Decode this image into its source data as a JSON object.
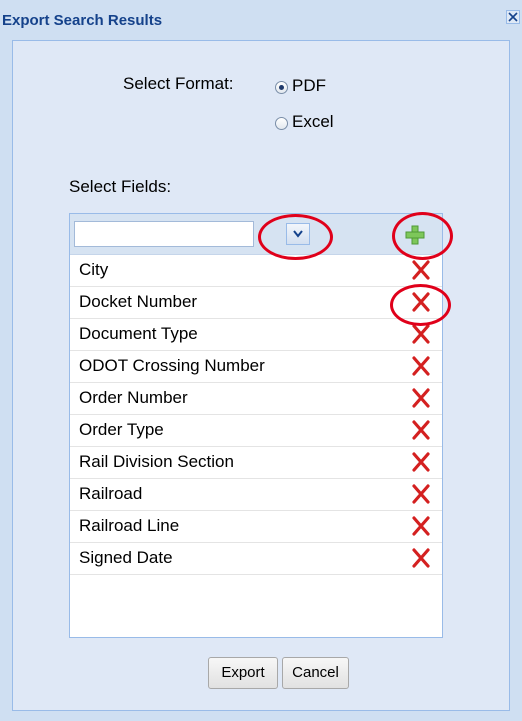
{
  "dialog": {
    "title": "Export Search Results",
    "close_icon": "close-icon"
  },
  "format": {
    "label": "Select Format:",
    "options": [
      {
        "label": "PDF",
        "selected": true
      },
      {
        "label": "Excel",
        "selected": false
      }
    ]
  },
  "fields": {
    "label": "Select Fields:",
    "combo_value": "",
    "dropdown_icon": "chevron-down-icon",
    "add_icon": "plus-icon",
    "remove_icon": "x-icon",
    "items": [
      {
        "label": "City"
      },
      {
        "label": "Docket Number"
      },
      {
        "label": "Document Type"
      },
      {
        "label": "ODOT Crossing Number"
      },
      {
        "label": "Order Number"
      },
      {
        "label": "Order Type"
      },
      {
        "label": "Rail Division Section"
      },
      {
        "label": "Railroad"
      },
      {
        "label": "Railroad Line"
      },
      {
        "label": "Signed Date"
      }
    ]
  },
  "buttons": {
    "export_label": "Export",
    "cancel_label": "Cancel"
  },
  "colors": {
    "title": "#15428b",
    "panel": "#dfe8f6",
    "annotation": "#e0001a",
    "add": "#6fbf4a",
    "remove": "#d42020"
  }
}
